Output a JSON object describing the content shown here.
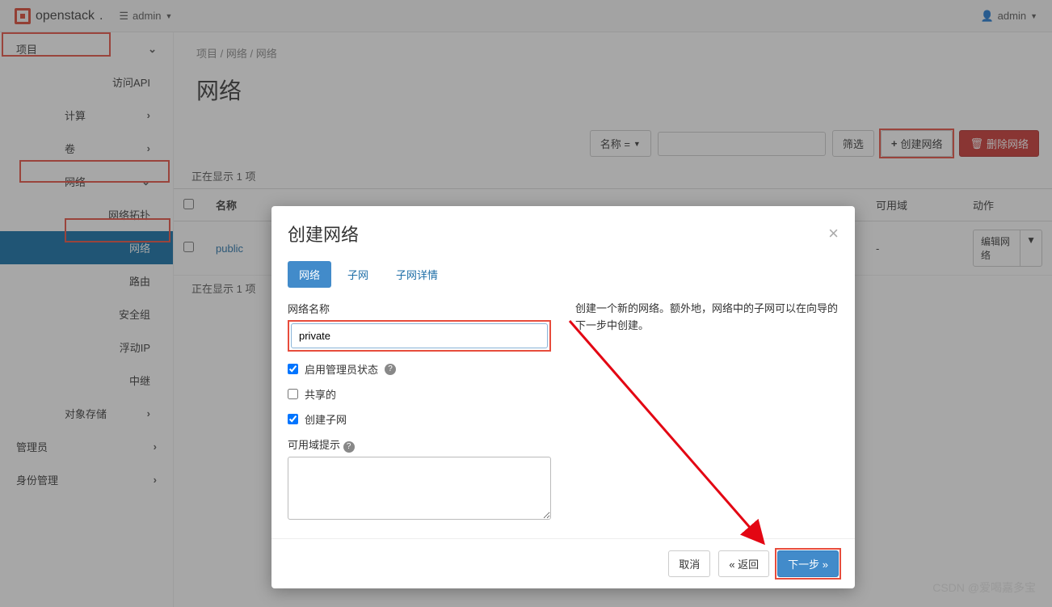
{
  "topbar": {
    "brand": "openstack",
    "project_label": "admin",
    "user_label": "admin"
  },
  "sidebar": {
    "project": "项目",
    "api": "访问API",
    "compute": "计算",
    "volume": "卷",
    "network": "网络",
    "network_items": {
      "topology": "网络拓扑",
      "networks": "网络",
      "routers": "路由",
      "security_groups": "安全组",
      "floating_ips": "浮动IP",
      "trunks": "中继"
    },
    "object_store": "对象存储",
    "admin": "管理员",
    "identity": "身份管理"
  },
  "breadcrumb": {
    "p1": "项目",
    "p2": "网络",
    "p3": "网络"
  },
  "page_title": "网络",
  "toolbar": {
    "name_eq": "名称 =",
    "filter": "筛选",
    "create": "创建网络",
    "delete": "删除网络"
  },
  "showing": "正在显示 1 项",
  "table": {
    "cols": {
      "name": "名称",
      "zone": "可用域",
      "action": "动作"
    },
    "rows": [
      {
        "name": "public",
        "zone": "-",
        "action": "编辑网络"
      }
    ]
  },
  "modal": {
    "title": "创建网络",
    "tabs": {
      "net": "网络",
      "subnet": "子网",
      "subnet_detail": "子网详情"
    },
    "labels": {
      "name": "网络名称",
      "admin_state": "启用管理员状态",
      "shared": "共享的",
      "create_subnet": "创建子网",
      "az_hint": "可用域提示"
    },
    "name_value": "private",
    "helptext": "创建一个新的网络。额外地，网络中的子网可以在向导的下一步中创建。",
    "footer": {
      "cancel": "取消",
      "back": "«  返回",
      "next": "下一步  »"
    }
  },
  "watermark": "CSDN @爱喝嘉多宝"
}
